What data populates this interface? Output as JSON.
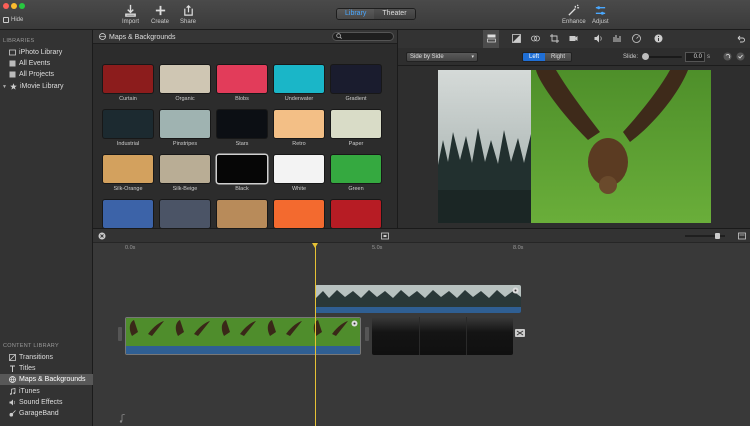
{
  "toolbar": {
    "hide_label": "Hide",
    "import_label": "Import",
    "create_label": "Create",
    "share_label": "Share",
    "library_tab": "Library",
    "theater_tab": "Theater",
    "enhance_label": "Enhance",
    "adjust_label": "Adjust"
  },
  "sidebar": {
    "libraries_header": "LIBRARIES",
    "libraries": [
      {
        "label": "iPhoto Library",
        "icon": "photo-icon"
      },
      {
        "label": "All Events",
        "icon": "events-icon"
      },
      {
        "label": "All Projects",
        "icon": "projects-icon"
      },
      {
        "label": "iMovie Library",
        "icon": "star-icon"
      }
    ],
    "content_header": "CONTENT LIBRARY",
    "content": [
      {
        "label": "Transitions",
        "icon": "transitions-icon"
      },
      {
        "label": "Titles",
        "icon": "titles-icon"
      },
      {
        "label": "Maps & Backgrounds",
        "icon": "globe-icon",
        "selected": true
      },
      {
        "label": "iTunes",
        "icon": "music-icon"
      },
      {
        "label": "Sound Effects",
        "icon": "speaker-icon"
      },
      {
        "label": "GarageBand",
        "icon": "guitar-icon"
      }
    ]
  },
  "browser": {
    "title": "Maps & Backgrounds",
    "search_placeholder": "",
    "tiles": [
      {
        "label": "Curtain",
        "color": "#8c1c1c"
      },
      {
        "label": "Organic",
        "color": "#cfc6b3"
      },
      {
        "label": "Blobs",
        "color": "#e23c5a"
      },
      {
        "label": "Underwater",
        "color": "#1ab6c8"
      },
      {
        "label": "Gradient",
        "color": "#1a1c2e"
      },
      {
        "label": "Industrial",
        "color": "#1c2a30"
      },
      {
        "label": "Pinstripes",
        "color": "#9fb3b1"
      },
      {
        "label": "Stars",
        "color": "#0c0f14"
      },
      {
        "label": "Retro",
        "color": "#f3bf86"
      },
      {
        "label": "Paper",
        "color": "#d9dcc7"
      },
      {
        "label": "Silk-Orange",
        "color": "#d3a15e"
      },
      {
        "label": "Silk-Beige",
        "color": "#b9ad95"
      },
      {
        "label": "Black",
        "color": "#060606",
        "selected": true
      },
      {
        "label": "White",
        "color": "#f3f3f3"
      },
      {
        "label": "Green",
        "color": "#35a940"
      },
      {
        "label": "",
        "color": "#3c63a8"
      },
      {
        "label": "",
        "color": "#4b5466"
      },
      {
        "label": "",
        "color": "#b88b5a"
      },
      {
        "label": "",
        "color": "#f36a2f"
      },
      {
        "label": "",
        "color": "#b71c24"
      }
    ]
  },
  "inspector": {
    "layout_dropdown": "Side by Side",
    "left_label": "Left",
    "right_label": "Right",
    "slide_label": "Slide:",
    "slide_value": "0.0",
    "slide_unit": "s"
  },
  "timeline": {
    "ruler": [
      "0.0s",
      "5.0s",
      "8.0s"
    ]
  }
}
